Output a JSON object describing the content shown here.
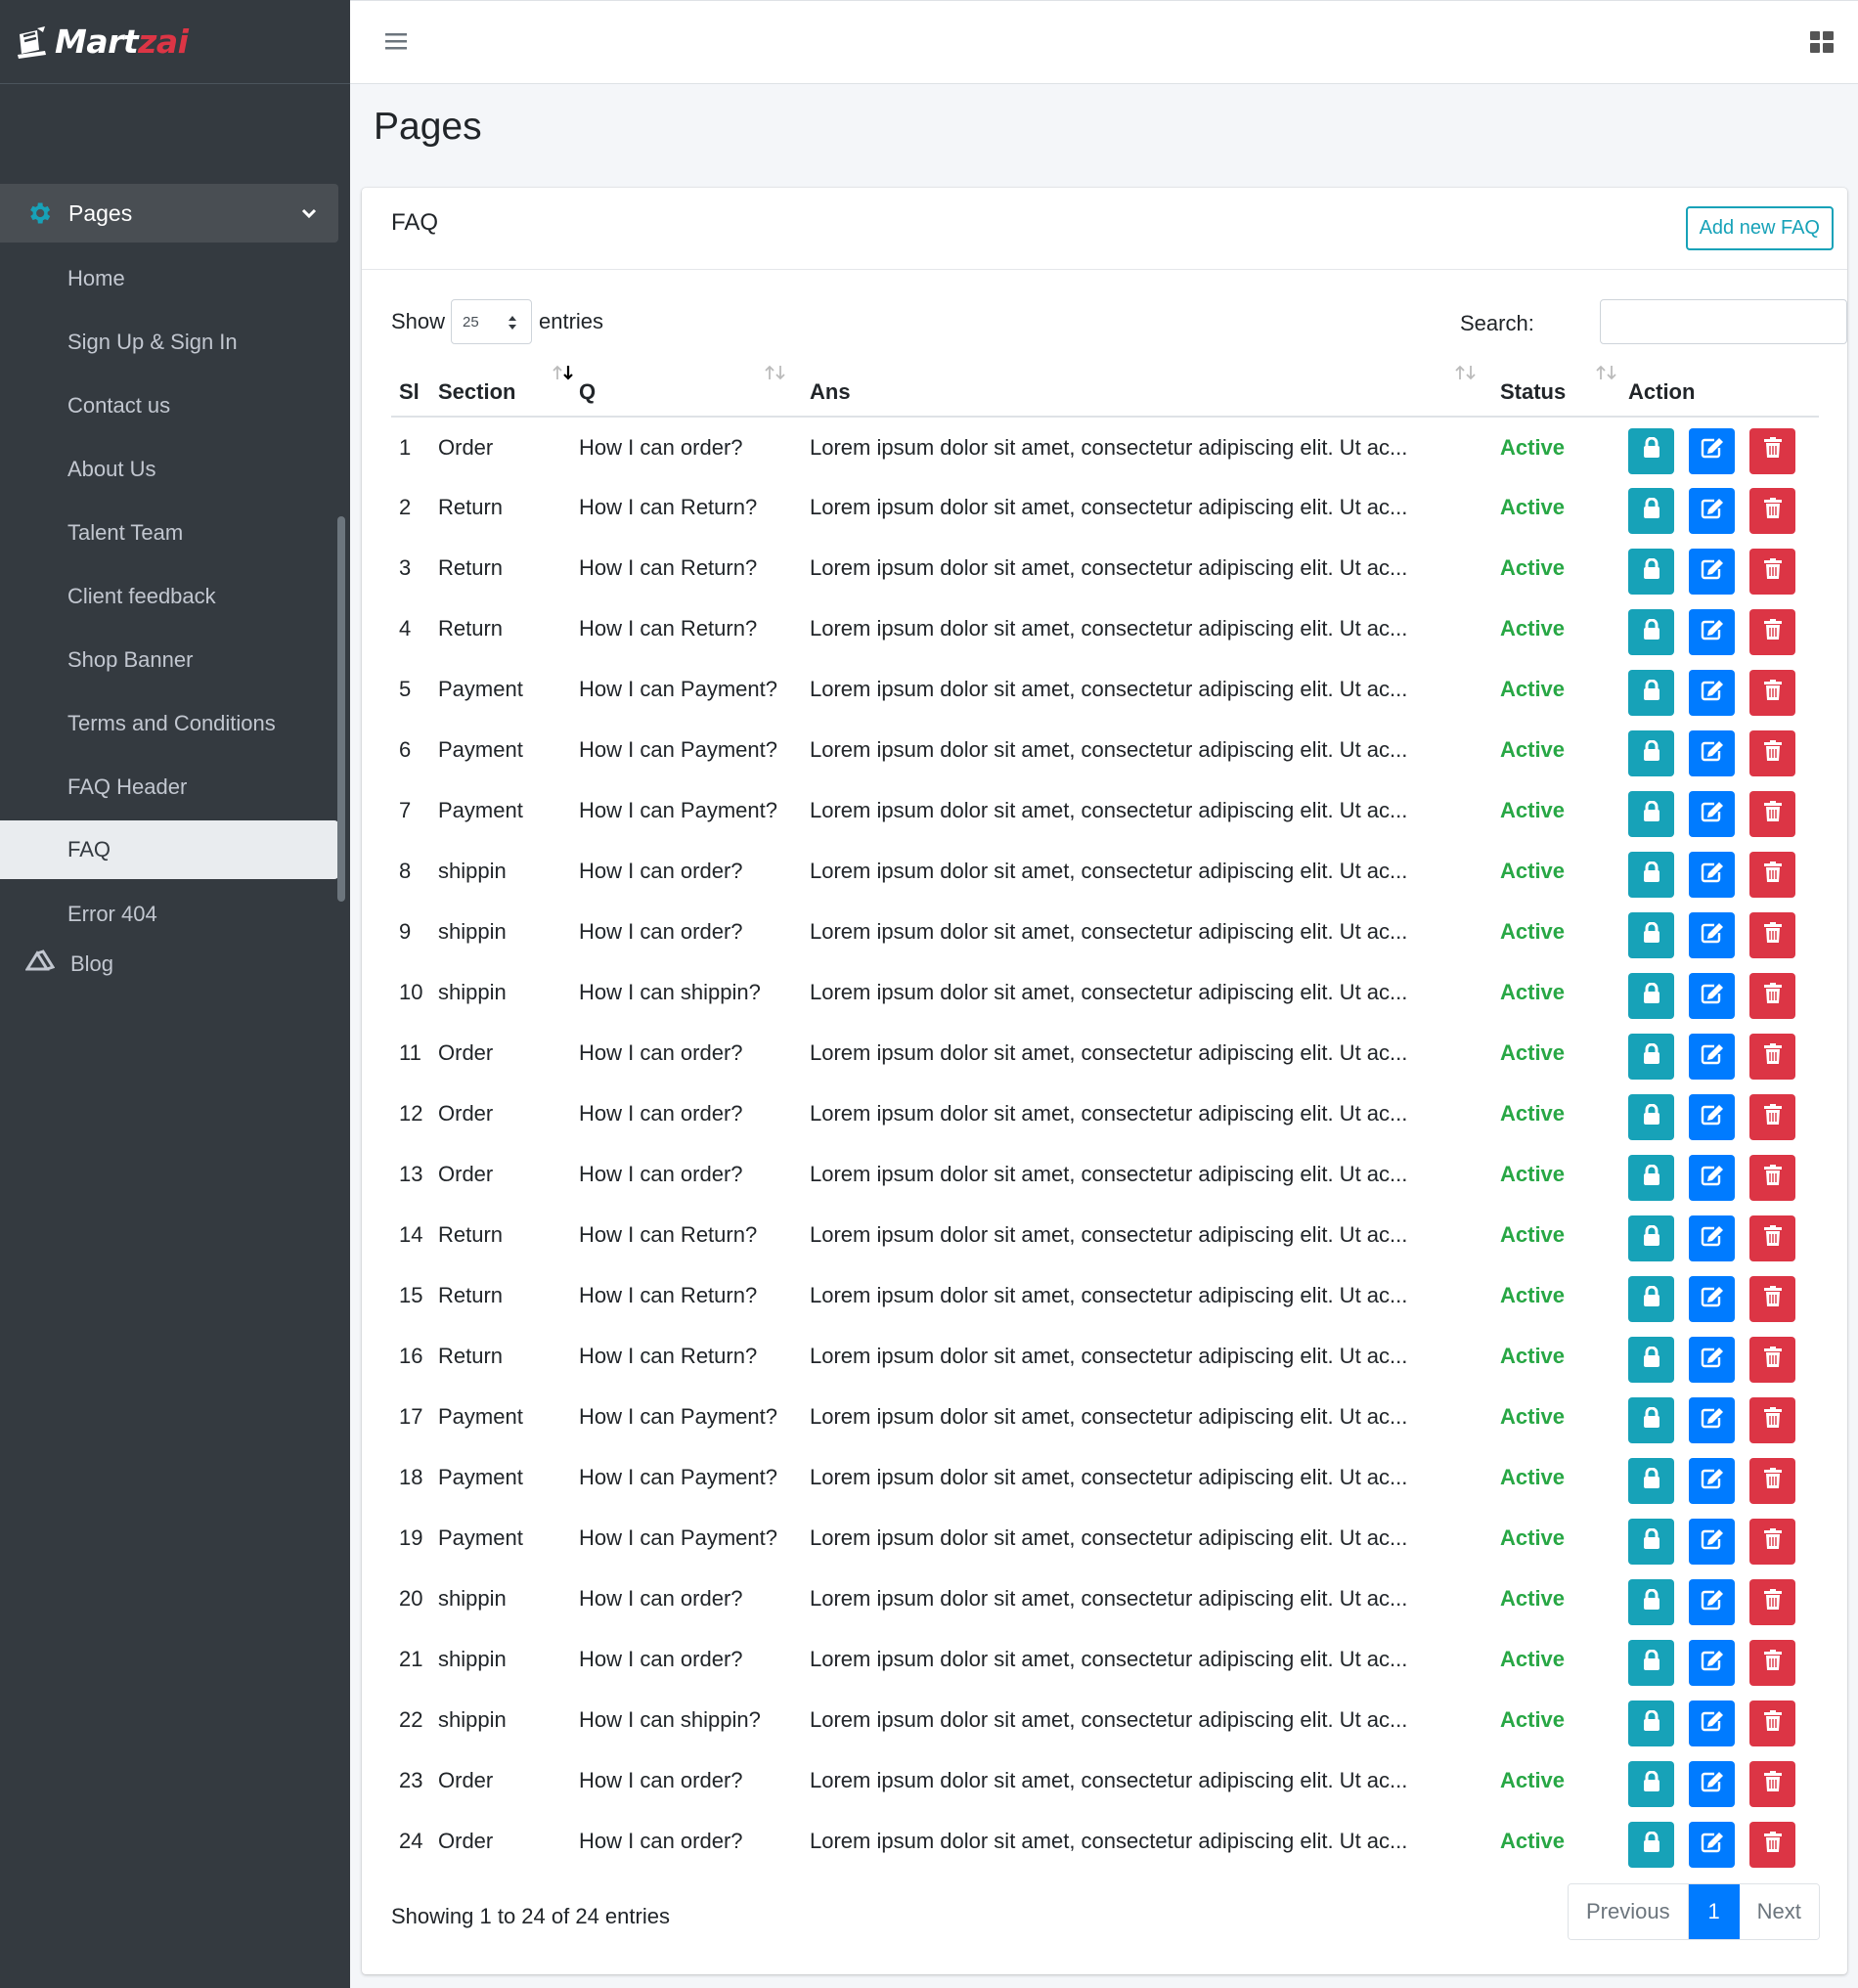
{
  "brand": {
    "name_part1": "Mart",
    "name_part2": "zai"
  },
  "sidebar": {
    "parent_label": "Pages",
    "items": [
      {
        "label": "Home"
      },
      {
        "label": "Sign Up & Sign In"
      },
      {
        "label": "Contact us"
      },
      {
        "label": "About Us"
      },
      {
        "label": "Talent Team"
      },
      {
        "label": "Client feedback"
      },
      {
        "label": "Shop Banner"
      },
      {
        "label": "Terms and Conditions"
      },
      {
        "label": "FAQ Header"
      },
      {
        "label": "FAQ"
      },
      {
        "label": "Error 404"
      }
    ],
    "blog_label": "Blog",
    "active_label": "FAQ"
  },
  "page": {
    "title": "Pages"
  },
  "card": {
    "title": "FAQ",
    "add_button": "Add new FAQ"
  },
  "controls": {
    "show_label": "Show",
    "entries_value": "25",
    "entries_label": "entries",
    "search_label": "Search:"
  },
  "table": {
    "headers": {
      "sl": "Sl",
      "section": "Section",
      "q": "Q",
      "ans": "Ans",
      "status": "Status",
      "action": "Action"
    },
    "rows": [
      {
        "sl": "1",
        "section": "Order",
        "q": "How I can order?",
        "ans": "Lorem ipsum dolor sit amet, consectetur adipiscing elit. Ut ac...",
        "status": "Active"
      },
      {
        "sl": "2",
        "section": "Return",
        "q": "How I can Return?",
        "ans": "Lorem ipsum dolor sit amet, consectetur adipiscing elit. Ut ac...",
        "status": "Active"
      },
      {
        "sl": "3",
        "section": "Return",
        "q": "How I can Return?",
        "ans": "Lorem ipsum dolor sit amet, consectetur adipiscing elit. Ut ac...",
        "status": "Active"
      },
      {
        "sl": "4",
        "section": "Return",
        "q": "How I can Return?",
        "ans": "Lorem ipsum dolor sit amet, consectetur adipiscing elit. Ut ac...",
        "status": "Active"
      },
      {
        "sl": "5",
        "section": "Payment",
        "q": "How I can Payment?",
        "ans": "Lorem ipsum dolor sit amet, consectetur adipiscing elit. Ut ac...",
        "status": "Active"
      },
      {
        "sl": "6",
        "section": "Payment",
        "q": "How I can Payment?",
        "ans": "Lorem ipsum dolor sit amet, consectetur adipiscing elit. Ut ac...",
        "status": "Active"
      },
      {
        "sl": "7",
        "section": "Payment",
        "q": "How I can Payment?",
        "ans": "Lorem ipsum dolor sit amet, consectetur adipiscing elit. Ut ac...",
        "status": "Active"
      },
      {
        "sl": "8",
        "section": "shippin",
        "q": "How I can order?",
        "ans": "Lorem ipsum dolor sit amet, consectetur adipiscing elit. Ut ac...",
        "status": "Active"
      },
      {
        "sl": "9",
        "section": "shippin",
        "q": "How I can order?",
        "ans": "Lorem ipsum dolor sit amet, consectetur adipiscing elit. Ut ac...",
        "status": "Active"
      },
      {
        "sl": "10",
        "section": "shippin",
        "q": "How I can shippin?",
        "ans": "Lorem ipsum dolor sit amet, consectetur adipiscing elit. Ut ac...",
        "status": "Active"
      },
      {
        "sl": "11",
        "section": "Order",
        "q": "How I can order?",
        "ans": "Lorem ipsum dolor sit amet, consectetur adipiscing elit. Ut ac...",
        "status": "Active"
      },
      {
        "sl": "12",
        "section": "Order",
        "q": "How I can order?",
        "ans": "Lorem ipsum dolor sit amet, consectetur adipiscing elit. Ut ac...",
        "status": "Active"
      },
      {
        "sl": "13",
        "section": "Order",
        "q": "How I can order?",
        "ans": "Lorem ipsum dolor sit amet, consectetur adipiscing elit. Ut ac...",
        "status": "Active"
      },
      {
        "sl": "14",
        "section": "Return",
        "q": "How I can Return?",
        "ans": "Lorem ipsum dolor sit amet, consectetur adipiscing elit. Ut ac...",
        "status": "Active"
      },
      {
        "sl": "15",
        "section": "Return",
        "q": "How I can Return?",
        "ans": "Lorem ipsum dolor sit amet, consectetur adipiscing elit. Ut ac...",
        "status": "Active"
      },
      {
        "sl": "16",
        "section": "Return",
        "q": "How I can Return?",
        "ans": "Lorem ipsum dolor sit amet, consectetur adipiscing elit. Ut ac...",
        "status": "Active"
      },
      {
        "sl": "17",
        "section": "Payment",
        "q": "How I can Payment?",
        "ans": "Lorem ipsum dolor sit amet, consectetur adipiscing elit. Ut ac...",
        "status": "Active"
      },
      {
        "sl": "18",
        "section": "Payment",
        "q": "How I can Payment?",
        "ans": "Lorem ipsum dolor sit amet, consectetur adipiscing elit. Ut ac...",
        "status": "Active"
      },
      {
        "sl": "19",
        "section": "Payment",
        "q": "How I can Payment?",
        "ans": "Lorem ipsum dolor sit amet, consectetur adipiscing elit. Ut ac...",
        "status": "Active"
      },
      {
        "sl": "20",
        "section": "shippin",
        "q": "How I can order?",
        "ans": "Lorem ipsum dolor sit amet, consectetur adipiscing elit. Ut ac...",
        "status": "Active"
      },
      {
        "sl": "21",
        "section": "shippin",
        "q": "How I can order?",
        "ans": "Lorem ipsum dolor sit amet, consectetur adipiscing elit. Ut ac...",
        "status": "Active"
      },
      {
        "sl": "22",
        "section": "shippin",
        "q": "How I can shippin?",
        "ans": "Lorem ipsum dolor sit amet, consectetur adipiscing elit. Ut ac...",
        "status": "Active"
      },
      {
        "sl": "23",
        "section": "Order",
        "q": "How I can order?",
        "ans": "Lorem ipsum dolor sit amet, consectetur adipiscing elit. Ut ac...",
        "status": "Active"
      },
      {
        "sl": "24",
        "section": "Order",
        "q": "How I can order?",
        "ans": "Lorem ipsum dolor sit amet, consectetur adipiscing elit. Ut ac...",
        "status": "Active"
      }
    ],
    "actions": [
      "lock-icon",
      "edit-icon",
      "trash-icon"
    ]
  },
  "footer": {
    "info": "Showing 1 to 24 of 24 entries",
    "prev": "Previous",
    "current": "1",
    "next": "Next"
  },
  "colors": {
    "sidebar": "#343a40",
    "info": "#17a2b8",
    "primary": "#007bff",
    "danger": "#dc3545",
    "success": "#28a745"
  }
}
